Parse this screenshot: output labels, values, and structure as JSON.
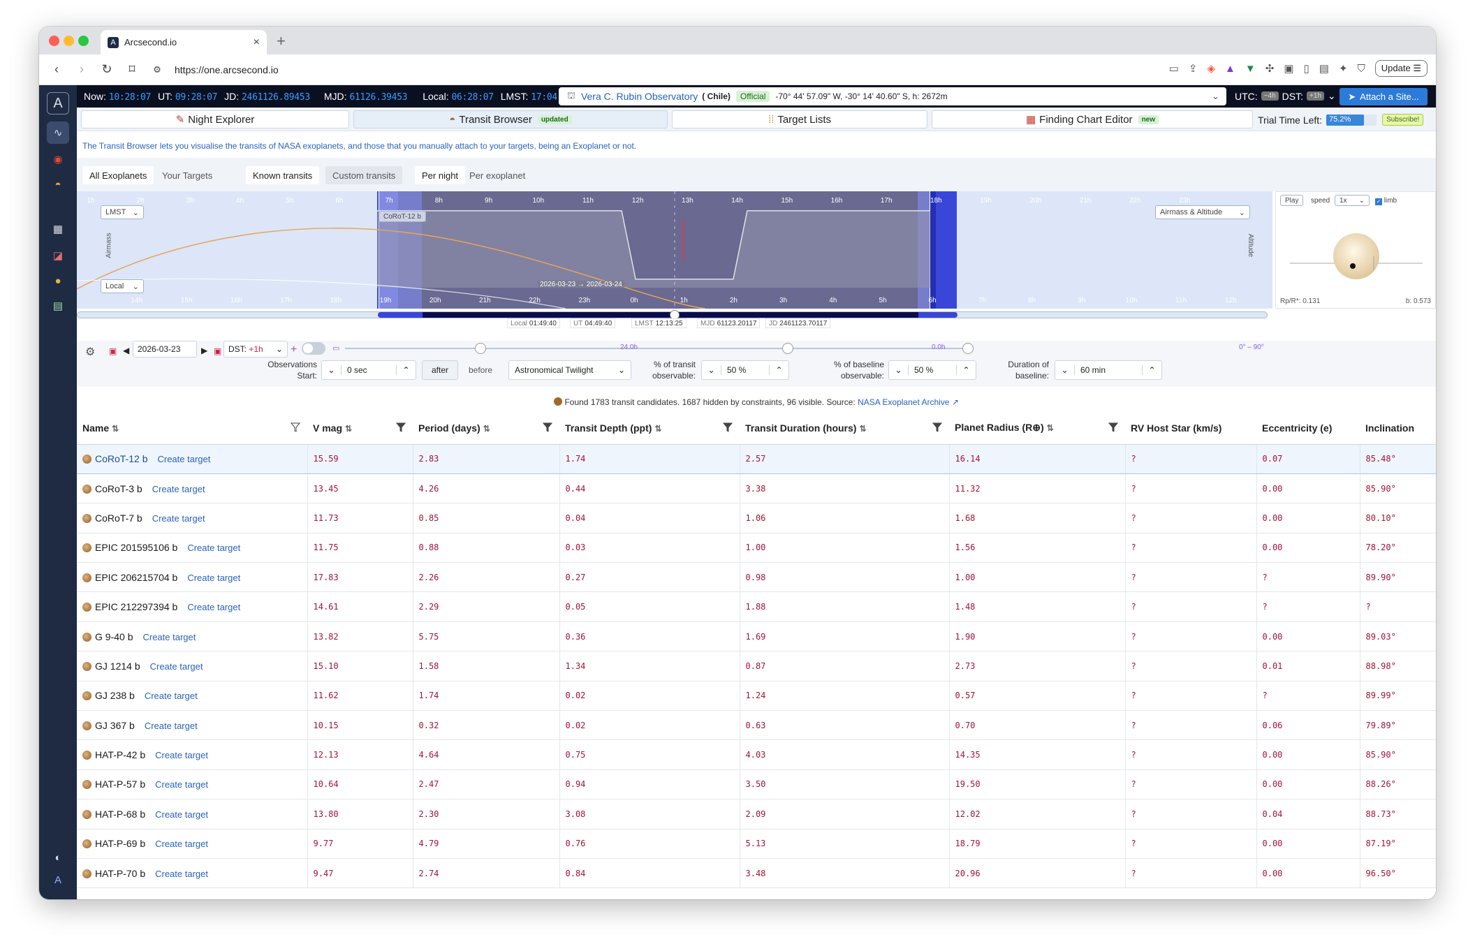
{
  "browser": {
    "tab_title": "Arcsecond.io",
    "url": "https://one.arcsecond.io",
    "update_label": "Update"
  },
  "topbar": {
    "now_label": "Now:",
    "now": "10:28:07",
    "ut_label": "UT:",
    "ut": "09:28:07",
    "jd_label": "JD:",
    "jd": "2461126.89453",
    "mjd_label": "MJD:",
    "mjd": "61126.39453",
    "local_label": "Local:",
    "local": "06:28:07",
    "lmst_label": "LMST:",
    "lmst": "17:04:27",
    "site_name": "Vera C. Rubin Observatory",
    "site_country": "( Chile)",
    "site_badge": "Official",
    "site_coords": "-70° 44' 57.09\" W, -30° 14' 40.60\" S, h: 2672m",
    "utc_label": "UTC:",
    "utc_offset": "−4h",
    "dst_label": "DST:",
    "dst_offset": "+1h",
    "attach_label": "Attach a Site..."
  },
  "main_tabs": {
    "night_explorer": "Night Explorer",
    "transit_browser": "Transit Browser",
    "transit_badge": "updated",
    "target_lists": "Target Lists",
    "finding_chart": "Finding Chart Editor",
    "finding_badge": "new",
    "trial_label": "Trial Time Left:",
    "trial_value": "75.2%",
    "trial_fraction": 0.752,
    "subscribe_label": "Subscribe!"
  },
  "description": "The Transit Browser lets you visualise the transits of NASA exoplanets, and those that you manually attach to your targets, being an Exoplanet or not.",
  "filters": {
    "all_exoplanets": "All Exoplanets",
    "your_targets": "Your Targets",
    "known_transits": "Known transits",
    "custom_transits": "Custom transits",
    "per_night": "Per night",
    "per_exoplanet": "Per exoplanet"
  },
  "timeline": {
    "lmst_select": "LMST",
    "local_select": "Local",
    "airmass_select": "Airmass & Altitude",
    "airmass_label": "Airmass",
    "altitude_label": "Altitude",
    "transit_name": "CoRoT-12 b",
    "transit_dates": "2026-03-23 → 2026-03-24",
    "top_ticks": [
      "1h",
      "2h",
      "3h",
      "4h",
      "5h",
      "6h",
      "7h",
      "8h",
      "9h",
      "10h",
      "11h",
      "12h",
      "13h",
      "14h",
      "15h",
      "16h",
      "17h",
      "18h",
      "19h",
      "20h",
      "21h",
      "22h",
      "23h"
    ],
    "bottom_ticks": [
      "14h",
      "15h",
      "16h",
      "17h",
      "18h",
      "19h",
      "20h",
      "21h",
      "22h",
      "23h",
      "0h",
      "1h",
      "2h",
      "3h",
      "4h",
      "5h",
      "6h",
      "7h",
      "8h",
      "9h",
      "10h",
      "11h",
      "12h",
      "13h"
    ],
    "status": {
      "local_label": "Local",
      "local": "01:49:40",
      "ut_label": "UT",
      "ut": "04:49:40",
      "lmst_label": "LMST",
      "lmst": "12:13:25",
      "mjd_label": "MJD",
      "mjd": "61123.20117",
      "jd_label": "JD",
      "jd": "2461123.70117"
    }
  },
  "preview": {
    "play_label": "Play",
    "speed_label": "speed",
    "speed_value": "1x",
    "limb_label": "limb",
    "rp_label": "Rp/R*: 0.131",
    "b_label": "b: 0.573"
  },
  "controls": {
    "date": "2026-03-23",
    "dst_label": "DST:",
    "dst_value": "+1h",
    "slider1_label": "24.0h",
    "slider2_label": "0.0h",
    "slider3_label": "0° – 90°",
    "obs_start_label": "Observations Start:",
    "obs_start_value": "0 sec",
    "after_label": "after",
    "before_label": "before",
    "twilight_value": "Astronomical Twilight",
    "transit_obs_label": "% of transit observable:",
    "transit_obs_value": "50 %",
    "baseline_obs_label": "% of baseline observable:",
    "baseline_obs_value": "50 %",
    "baseline_dur_label": "Duration of baseline:",
    "baseline_dur_value": "60 min"
  },
  "found": {
    "text": "Found 1783 transit candidates. 1687 hidden by constraints, 96 visible. Source:",
    "source_link": "NASA Exoplanet Archive"
  },
  "table": {
    "headers": [
      "Name",
      "V mag",
      "Period (days)",
      "Transit Depth (ppt)",
      "Transit Duration (hours)",
      "Planet Radius (R⊕)",
      "RV Host Star (km/s)",
      "Eccentricity (e)",
      "Inclination"
    ],
    "create_label": "Create target",
    "rows": [
      [
        "CoRoT-12 b",
        "15.59",
        "2.83",
        "1.74",
        "2.57",
        "16.14",
        "?",
        "0.07",
        "85.48°"
      ],
      [
        "CoRoT-3 b",
        "13.45",
        "4.26",
        "0.44",
        "3.38",
        "11.32",
        "?",
        "0.00",
        "85.90°"
      ],
      [
        "CoRoT-7 b",
        "11.73",
        "0.85",
        "0.04",
        "1.06",
        "1.68",
        "?",
        "0.00",
        "80.10°"
      ],
      [
        "EPIC 201595106 b",
        "11.75",
        "0.88",
        "0.03",
        "1.00",
        "1.56",
        "?",
        "0.00",
        "78.20°"
      ],
      [
        "EPIC 206215704 b",
        "17.83",
        "2.26",
        "0.27",
        "0.98",
        "1.00",
        "?",
        "?",
        "89.90°"
      ],
      [
        "EPIC 212297394 b",
        "14.61",
        "2.29",
        "0.05",
        "1.88",
        "1.48",
        "?",
        "?",
        "?"
      ],
      [
        "G 9-40 b",
        "13.82",
        "5.75",
        "0.36",
        "1.69",
        "1.90",
        "?",
        "0.00",
        "89.03°"
      ],
      [
        "GJ 1214 b",
        "15.10",
        "1.58",
        "1.34",
        "0.87",
        "2.73",
        "?",
        "0.01",
        "88.98°"
      ],
      [
        "GJ 238 b",
        "11.62",
        "1.74",
        "0.02",
        "1.24",
        "0.57",
        "?",
        "?",
        "89.99°"
      ],
      [
        "GJ 367 b",
        "10.15",
        "0.32",
        "0.02",
        "0.63",
        "0.70",
        "?",
        "0.06",
        "79.89°"
      ],
      [
        "HAT-P-42 b",
        "12.13",
        "4.64",
        "0.75",
        "4.03",
        "14.35",
        "?",
        "0.00",
        "85.90°"
      ],
      [
        "HAT-P-57 b",
        "10.64",
        "2.47",
        "0.94",
        "3.50",
        "19.50",
        "?",
        "0.00",
        "88.26°"
      ],
      [
        "HAT-P-68 b",
        "13.80",
        "2.30",
        "3.08",
        "2.09",
        "12.02",
        "?",
        "0.04",
        "88.73°"
      ],
      [
        "HAT-P-69 b",
        "9.77",
        "4.79",
        "0.76",
        "5.13",
        "18.79",
        "?",
        "0.00",
        "87.19°"
      ],
      [
        "HAT-P-70 b",
        "9.47",
        "2.74",
        "0.84",
        "3.48",
        "20.96",
        "?",
        "0.00",
        "96.50°"
      ]
    ]
  },
  "colors": {
    "accent": "#2d7bd8",
    "sidebar": "#1e2b42",
    "night": "#0b0b4a",
    "value_red": "#a0143a"
  }
}
